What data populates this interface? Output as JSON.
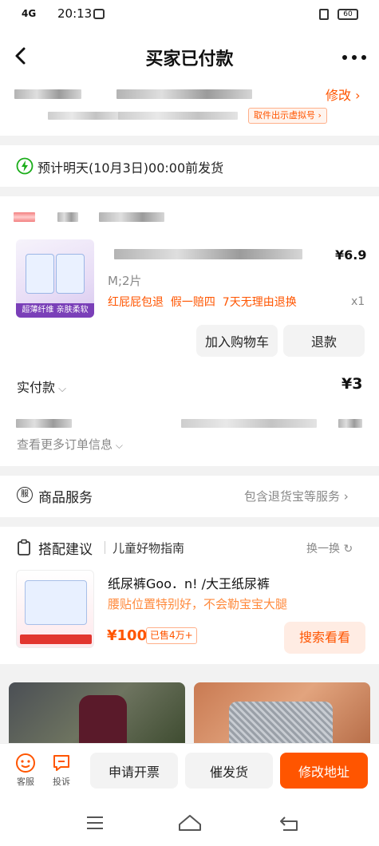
{
  "status_bar": {
    "signal": "4G",
    "time": "20:13",
    "battery": "60"
  },
  "header": {
    "title": "买家已付款"
  },
  "address": {
    "edit_label": "修改",
    "pickup_tag": "取件出示虚拟号"
  },
  "shipping": {
    "text": "预计明天(10月3日)00:00前发货"
  },
  "product": {
    "price": "¥6.9",
    "spec": "M;2片",
    "guarantees": "红屁屁包退  假一赔四  7天无理由退换",
    "qty": "x1",
    "image_caption": "超薄纤维 亲肤柔软",
    "add_cart": "加入购物车",
    "refund": "退款"
  },
  "payment": {
    "label": "实付款",
    "amount": "¥3",
    "more_info": "查看更多订单信息"
  },
  "service": {
    "label": "商品服务",
    "detail": "包含退货宝等服务"
  },
  "recommend": {
    "title": "搭配建议",
    "subtitle": "儿童好物指南",
    "refresh": "换一换",
    "item_title": "纸尿裤Goo．n! /大王纸尿裤",
    "item_desc": "腰贴位置特别好，不会勒宝宝大腿",
    "item_price": "¥100",
    "item_sold": "已售4万+",
    "search_btn": "搜索看看"
  },
  "bottom_bar": {
    "seller_label": "客服",
    "complaint_label": "投诉",
    "invoice": "申请开票",
    "urge": "催发货",
    "change_address": "修改地址"
  },
  "colors": {
    "accent": "#ff5500",
    "green": "#1aad19"
  }
}
